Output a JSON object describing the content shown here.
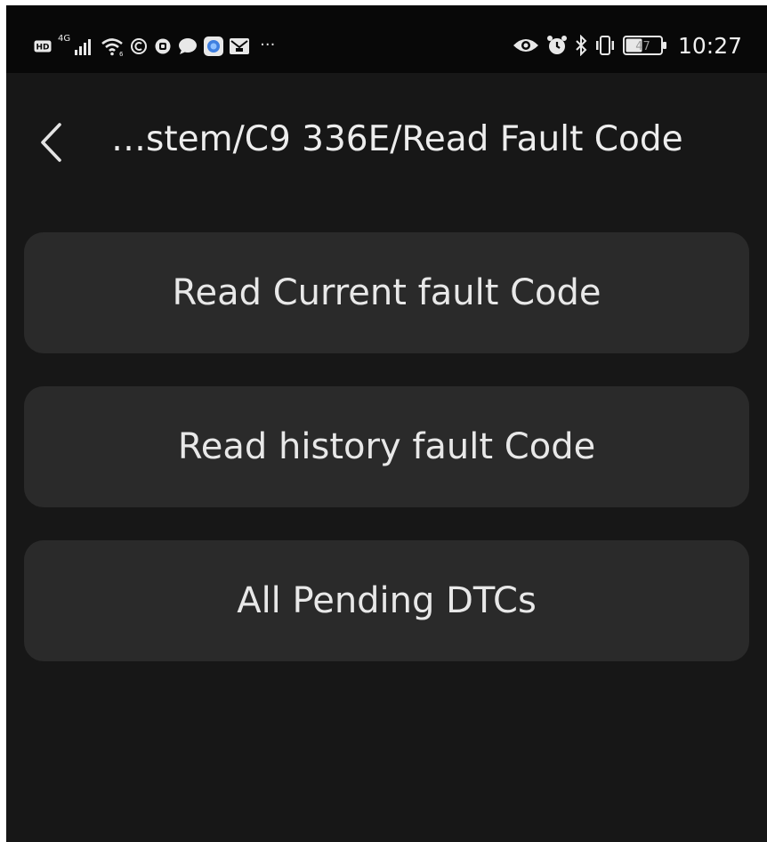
{
  "status_bar": {
    "network_type": "4G",
    "battery_level": "47",
    "time": "10:27",
    "overflow_indicator": "···",
    "left_icons": [
      "hd-icon",
      "signal-icon",
      "wifi-icon",
      "vpn-icon",
      "app-notification-icon",
      "chat-icon",
      "browser-icon",
      "mail-icon"
    ],
    "right_icons": [
      "eye-comfort-icon",
      "alarm-icon",
      "bluetooth-icon",
      "vibrate-icon",
      "battery-icon"
    ]
  },
  "header": {
    "back_icon": "chevron-left-icon",
    "title": "…stem/C9 336E/Read Fault Code"
  },
  "menu": {
    "items": [
      {
        "label": "Read Current fault Code"
      },
      {
        "label": "Read history fault Code"
      },
      {
        "label": "All Pending DTCs"
      }
    ]
  },
  "colors": {
    "background": "#171717",
    "status_bar": "#080808",
    "button": "#2a2a2a",
    "text": "#e8e8e8"
  }
}
